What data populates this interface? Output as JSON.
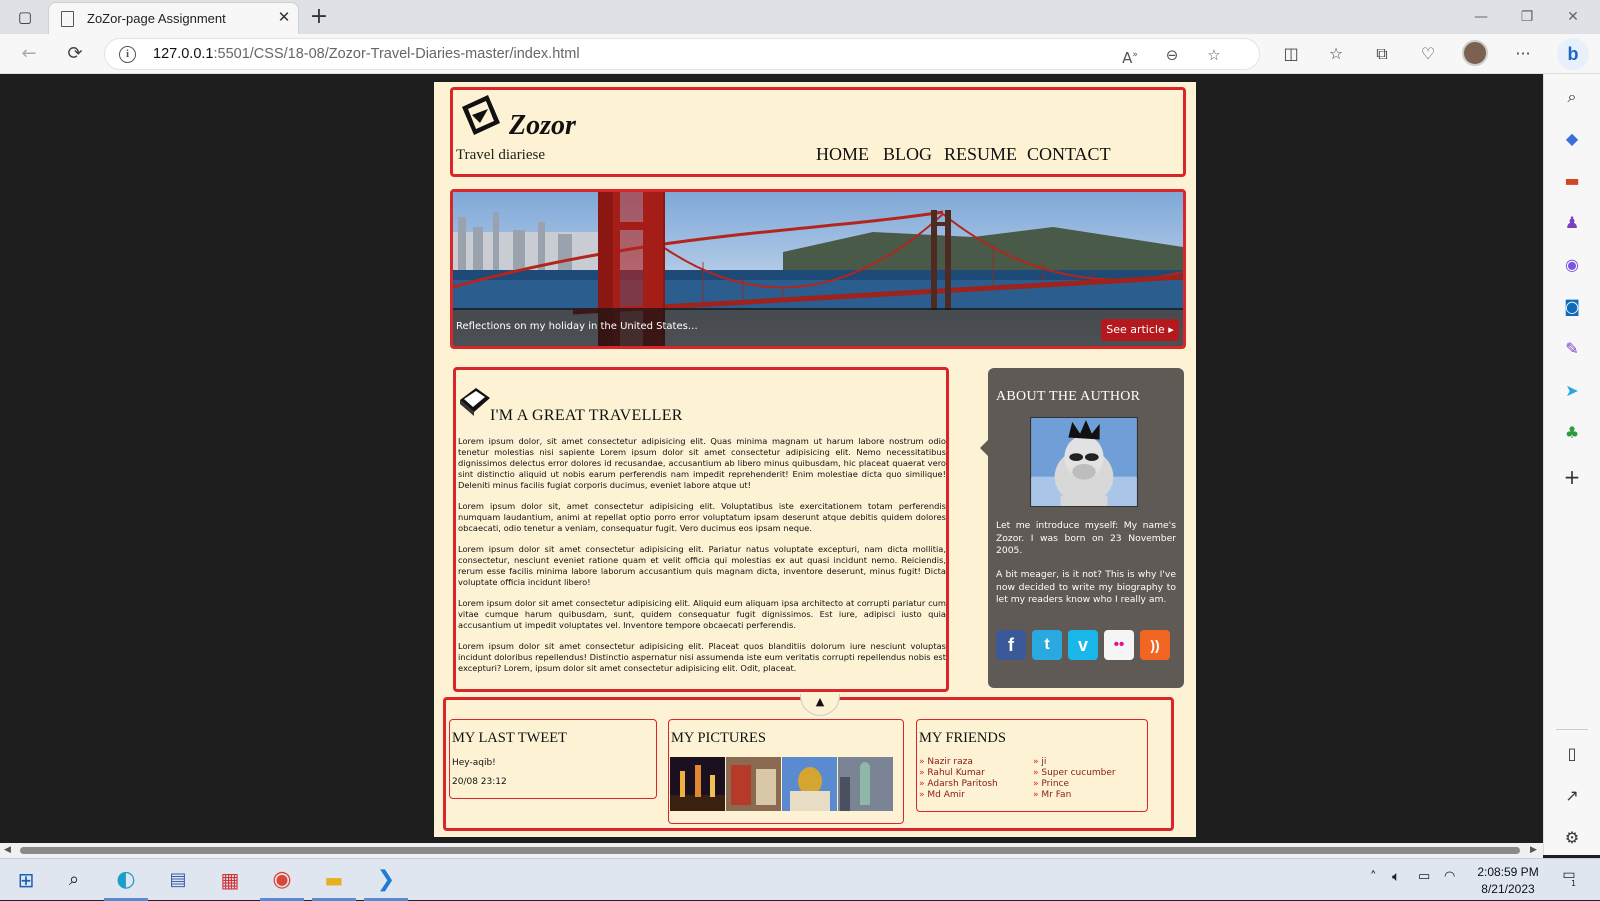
{
  "browser": {
    "tab_title": "ZoZor-page Assignment",
    "tab_close": "✕",
    "new_tab": "+",
    "url_host": "127.0.0.1",
    "url_path": ":5501/CSS/18-08/Zozor-Travel-Diaries-master/index.html",
    "window_controls": [
      "—",
      "❐",
      "✕"
    ],
    "nav": {
      "back": "←",
      "reload": "⟳"
    },
    "address_icons": [
      "read-aloud-icon",
      "zoom-icon",
      "favorite-star-icon"
    ],
    "toolbar_icons": [
      "split-screen-icon",
      "favorites-icon",
      "collections-icon",
      "browser-essentials-icon",
      "profile-icon",
      "more-icon"
    ],
    "bing": "b"
  },
  "sidebar_icons": [
    "search-icon",
    "shopping-icon",
    "tools-icon",
    "games-icon",
    "microsoft365-icon",
    "outlook-icon",
    "designer-icon",
    "telegram-icon",
    "tree-icon",
    "add-icon",
    "panel-icon",
    "open-external-icon",
    "settings-icon"
  ],
  "site": {
    "logo": "Zozor",
    "tagline": "Travel diariese",
    "nav": [
      "HOME",
      "BLOG",
      "RESUME",
      "CONTACT"
    ],
    "hero": {
      "caption": "Reflections on my holiday in the United States…",
      "button": "See article ▸"
    },
    "article": {
      "title": "I'M A GREAT TRAVELLER",
      "paragraphs": [
        "Lorem ipsum dolor, sit amet consectetur adipisicing elit. Quas minima magnam ut harum labore nostrum odio tenetur molestias nisi sapiente Lorem ipsum dolor sit amet consectetur adipisicing elit. Nemo necessitatibus dignissimos delectus error dolores id recusandae, accusantium ab libero minus quibusdam, hic placeat quaerat vero sint distinctio aliquid ut nobis earum perferendis nam impedit reprehenderit! Enim molestiae dicta quo similique! Deleniti minus facilis fugiat corporis ducimus, eveniet labore atque ut!",
        "Lorem ipsum dolor sit, amet consectetur adipisicing elit. Voluptatibus iste exercitationem totam perferendis numquam laudantium, animi at repellat optio porro error voluptatum ipsam deserunt atque debitis quidem dolores obcaecati, odio tenetur a veniam, consequatur fugit. Vero ducimus eos ipsam neque.",
        "Lorem ipsum dolor sit amet consectetur adipisicing elit. Pariatur natus voluptate excepturi, nam dicta mollitia, consectetur, nesciunt eveniet ratione quam et velit officia qui molestias ex aut quasi incidunt nemo. Reiciendis, rerum esse facilis minima labore laborum accusantium quis magnam dicta, inventore deserunt, minus fugit! Dicta voluptate officia incidunt libero!",
        "Lorem ipsum dolor sit amet consectetur adipisicing elit. Aliquid eum aliquam ipsa architecto at corrupti pariatur cum vitae cumque harum quibusdam, sunt, quidem consequatur fugit dignissimos. Est iure, adipisci iusto quia accusantium ut impedit voluptates vel. Inventore tempore obcaecati perferendis.",
        "Lorem ipsum dolor sit amet consectetur adipisicing elit. Placeat quos blanditiis dolorum iure nesciunt voluptas incidunt doloribus repellendus! Distinctio aspernatur nisi assumenda iste eum veritatis corrupti repellendus nobis est excepturi? Lorem, ipsum dolor sit amet consectetur adipisicing elit. Odit, placeat."
      ]
    },
    "author": {
      "title": "ABOUT THE AUTHOR",
      "p1": "Let me introduce myself: My name's Zozor. I was born on 23 November 2005.",
      "p2": "A bit meager, is it not? This is why I've now decided to write my biography to let my readers know who I really am.",
      "social": [
        {
          "name": "facebook-icon",
          "glyph": "f",
          "color": "#3b5998"
        },
        {
          "name": "twitter-icon",
          "glyph": "t",
          "color": "#2aa9e0"
        },
        {
          "name": "vimeo-icon",
          "glyph": "v",
          "color": "#1ab7ea"
        },
        {
          "name": "flickr-icon",
          "glyph": "••",
          "color": "#f5f5f5"
        },
        {
          "name": "rss-icon",
          "glyph": "))",
          "color": "#f26522"
        }
      ]
    },
    "tweet": {
      "title": "MY LAST TWEET",
      "text": "Hey-aqib!",
      "time": "20/08 23:12"
    },
    "pictures": {
      "title": "MY PICTURES"
    },
    "friends": {
      "title": "MY FRIENDS",
      "col1": [
        "Nazir raza",
        "Rahul Kumar",
        "Adarsh Paritosh",
        "Md Amir"
      ],
      "col2": [
        "ji",
        "Super cucumber",
        "Prince",
        "Mr Fan"
      ]
    }
  },
  "taskbar": {
    "time": "2:08:59 PM",
    "date": "8/21/2023",
    "notification_count": "1"
  }
}
